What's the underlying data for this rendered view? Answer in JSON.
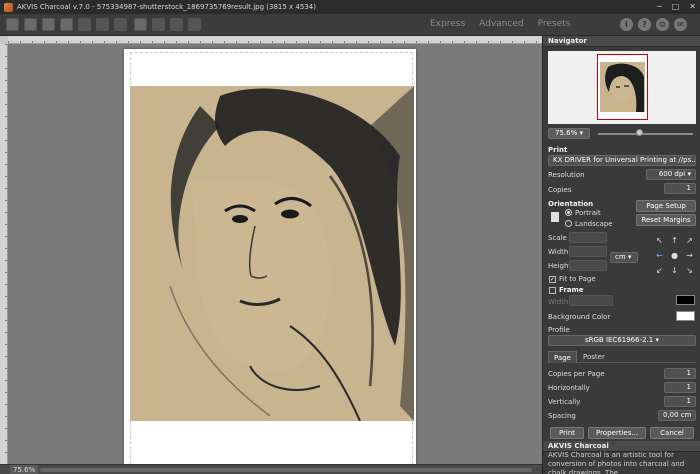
{
  "window": {
    "title": "AKVIS Charcoal v.7.0 - 575334987-shutterstock_1869735769result.jpg (3815 x 4534)"
  },
  "toolbar": {
    "modes": [
      "Express",
      "Advanced",
      "Presets"
    ]
  },
  "status": {
    "zoom": "75.6%"
  },
  "navigator": {
    "title": "Navigator",
    "zoom": "75.6%"
  },
  "print": {
    "section": "Print",
    "printer": "KX DRIVER for Universal Printing at //ps...",
    "resolution_label": "Resolution",
    "resolution_value": "600 dpi",
    "copies_label": "Copies",
    "copies_value": "1",
    "orientation_label": "Orientation",
    "portrait_label": "Portrait",
    "landscape_label": "Landscape",
    "page_setup_button": "Page Setup",
    "reset_margins_button": "Reset Margins",
    "scale_label": "Scale",
    "width_label": "Width",
    "height_label": "Height",
    "units_value": "cm",
    "fit_to_page_label": "Fit to Page",
    "frame_label": "Frame",
    "frame_width_label": "Width",
    "background_color_label": "Background Color",
    "profile_label": "Profile",
    "profile_value": "sRGB IEC61966-2.1"
  },
  "page_tab": {
    "tabs": [
      "Page",
      "Poster"
    ],
    "copies_per_page_label": "Copies per Page",
    "copies_per_page_value": "1",
    "horizontally_label": "Horizontally",
    "horizontally_value": "1",
    "vertically_label": "Vertically",
    "vertically_value": "1",
    "spacing_label": "Spacing",
    "spacing_value": "0,00 cm"
  },
  "actions": {
    "print": "Print",
    "properties": "Properties...",
    "cancel": "Cancel"
  },
  "about": {
    "title": "AKVIS Charcoal",
    "text": "AKVIS Charcoal is an artistic tool for conversion of photos into charcoal and chalk drawings. The"
  },
  "colors": {
    "frame_color": "#000000",
    "background_color": "#ffffff",
    "paper_tone": "#c8b48f"
  }
}
